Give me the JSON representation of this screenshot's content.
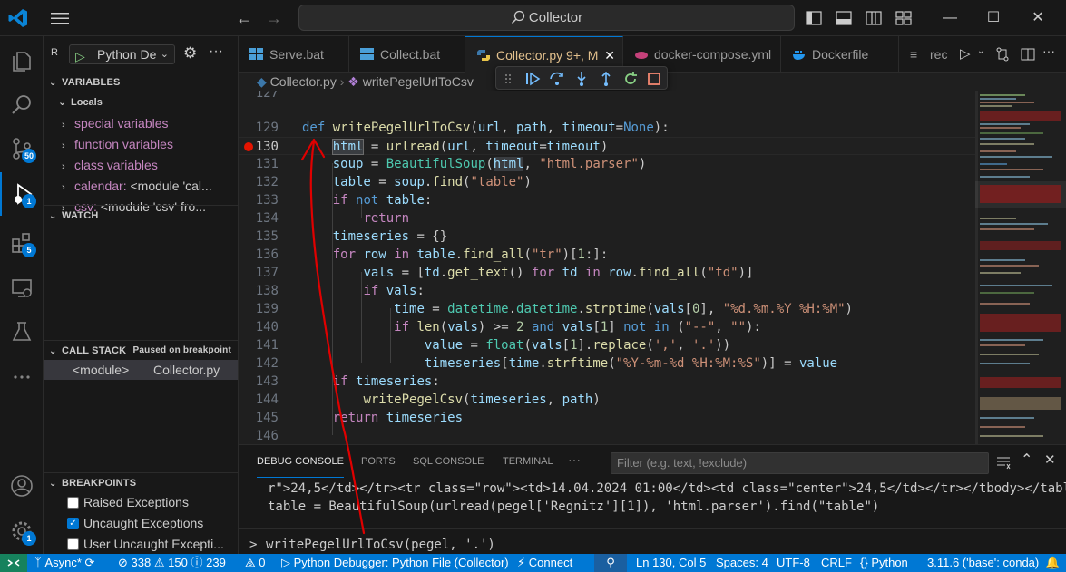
{
  "titlebar": {
    "search": "Collector"
  },
  "activitybar": {
    "badges": {
      "scm": "50",
      "debug": "1",
      "extensions": "5",
      "settings": "1"
    }
  },
  "sidebar": {
    "run_title": "R",
    "run_config": "Python De",
    "variables_header": "VARIABLES",
    "locals_label": "Locals",
    "variables": [
      {
        "name": "special variables",
        "value": ""
      },
      {
        "name": "function variables",
        "value": ""
      },
      {
        "name": "class variables",
        "value": ""
      },
      {
        "name": "calendar:",
        "value": "<module 'cal..."
      },
      {
        "name": "csv:",
        "value": "<module 'csv' fro..."
      }
    ],
    "watch_header": "WATCH",
    "callstack_header": "CALL STACK",
    "callstack_status": "Paused on breakpoint",
    "frame_name": "<module>",
    "frame_file": "Collector.py",
    "breakpoints_header": "BREAKPOINTS",
    "breakpoints": [
      {
        "label": "Raised Exceptions",
        "checked": false
      },
      {
        "label": "Uncaught Exceptions",
        "checked": true
      },
      {
        "label": "User Uncaught Excepti...",
        "checked": false
      }
    ]
  },
  "tabs": [
    {
      "label": "Serve.bat"
    },
    {
      "label": "Collect.bat"
    },
    {
      "label": "Collector.py",
      "suffix": "9+, M"
    },
    {
      "label": "docker-compose.yml"
    },
    {
      "label": "Dockerfile"
    },
    {
      "label": "rec"
    }
  ],
  "breadcrumb": {
    "file": "Collector.py",
    "symbol": "writePegelUrlToCsv"
  },
  "code": {
    "line_numbers": [
      "127",
      "129",
      "130",
      "131",
      "132",
      "133",
      "134",
      "135",
      "136",
      "137",
      "138",
      "139",
      "140",
      "141",
      "142",
      "143",
      "144",
      "145",
      "146"
    ],
    "current_line": "130"
  },
  "panel": {
    "tabs": [
      "DEBUG CONSOLE",
      "PORTS",
      "SQL CONSOLE",
      "TERMINAL"
    ],
    "filter_placeholder": "Filter (e.g. text, !exclude)",
    "output_line_1": "r\">24,5</td></tr><tr class=\"row\"><td>14.04.2024 01:00</td><td class=\"center\">24,5</td></tr></tbody></table>",
    "output_line_2": "table = BeautifulSoup(urlread(pegel['Regnitz'][1]), 'html.parser').find(\"table\")",
    "prompt_symbol": ">",
    "input": "writePegelUrlToCsv(pegel, '.')"
  },
  "statusbar": {
    "branch": "Async*",
    "errors": "338",
    "warnings": "150",
    "infos": "239",
    "ports": "0",
    "debugger": "Python Debugger: Python File (Collector)",
    "connect": "Connect",
    "position": "Ln 130, Col 5",
    "spaces": "Spaces: 4",
    "encoding": "UTF-8",
    "eol": "CRLF",
    "language": "Python",
    "interpreter": "3.11.6 ('base': conda)"
  },
  "colors": {
    "accent": "#0078d4",
    "breakpoint": "#e51400",
    "annotation": "#e00000"
  }
}
